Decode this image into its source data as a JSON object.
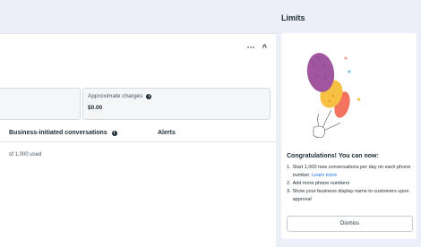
{
  "card": {
    "menu_more": "···",
    "menu_collapse": "^"
  },
  "stats": {
    "approx_label": "Approximate charges",
    "approx_value": "$0.00"
  },
  "table": {
    "col_business": "Business-initiated conversations",
    "col_alerts": "Alerts",
    "used_text": "of 1,000 used"
  },
  "limits": {
    "title": "Limits",
    "heading": "Congratulations! You can now:",
    "item1_text": "Start 1,000 new conversations per day on each phone number.",
    "item1_link": "Learn more",
    "item2_text": "Add more phone numbers",
    "item3_text": "Show your business display name to customers upon approval",
    "dismiss_label": "Dismiss"
  },
  "colors": {
    "page_bg": "#eceff8",
    "link": "#1877f2",
    "balloon_purple": "#a0559f",
    "balloon_yellow": "#f6c143",
    "balloon_red": "#f3735f"
  }
}
